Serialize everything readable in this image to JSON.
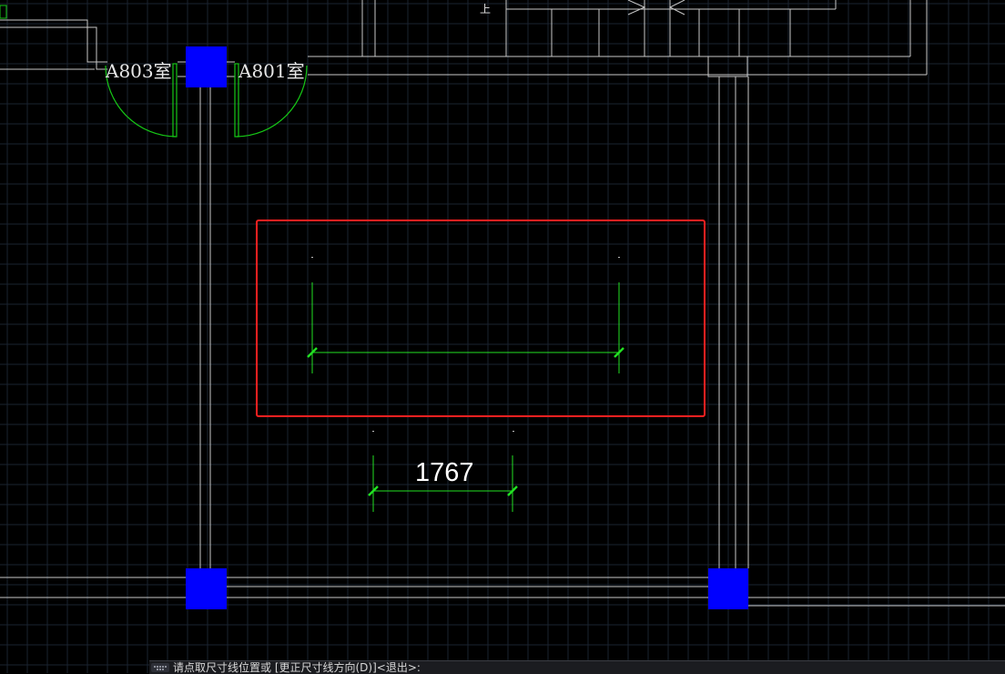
{
  "rooms": {
    "left_label": "A803室",
    "right_label": "A801室"
  },
  "stair": {
    "up_label": "上"
  },
  "dimension": {
    "value": "1767"
  },
  "command_line": {
    "prompt": "请点取尺寸线位置或 [更正尺寸线方向(D)]<退出>:"
  },
  "colors": {
    "background": "#000000",
    "grid": "#1a2330",
    "wall": "#c8c8c8",
    "door": "#16c816",
    "dimension": "#22e022",
    "column": "#0000ff",
    "selection_box": "#ff2020"
  }
}
